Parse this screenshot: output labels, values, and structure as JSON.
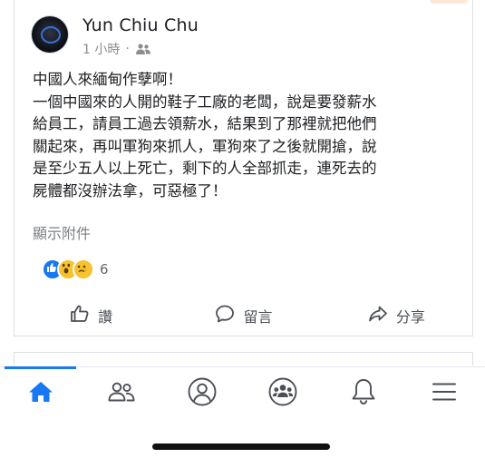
{
  "post": {
    "author": "Yun Chiu Chu",
    "time": "1 小時",
    "meta_separator": "·",
    "privacy_icon": "friends-icon",
    "body_lines": [
      "中國人來緬甸作孽啊！",
      "一個中國來的人開的鞋子工廠的老闆，說是要發薪水",
      "給員工，請員工過去領薪水，結果到了那裡就把他們",
      "關起來，再叫軍狗來抓人，軍狗來了之後就開搶，說",
      "是至少五人以上死亡，剩下的人全部抓走，連死去的",
      "屍體都沒辦法拿，可惡極了！"
    ],
    "attachment_label": "顯示附件",
    "reactions": {
      "icons": [
        "like-icon",
        "wow-icon",
        "sad-icon"
      ],
      "count": "6"
    },
    "actions": {
      "like": "讚",
      "comment": "留言",
      "share": "分享"
    }
  },
  "tabbar": {
    "items": [
      "home-icon",
      "friends-icon",
      "profile-icon",
      "groups-icon",
      "bell-icon",
      "menu-icon"
    ],
    "active": "home-icon"
  },
  "colors": {
    "accent": "#1877f2",
    "text": "#1c1e21",
    "secondary": "#65676b",
    "icon": "#4b4f56"
  }
}
